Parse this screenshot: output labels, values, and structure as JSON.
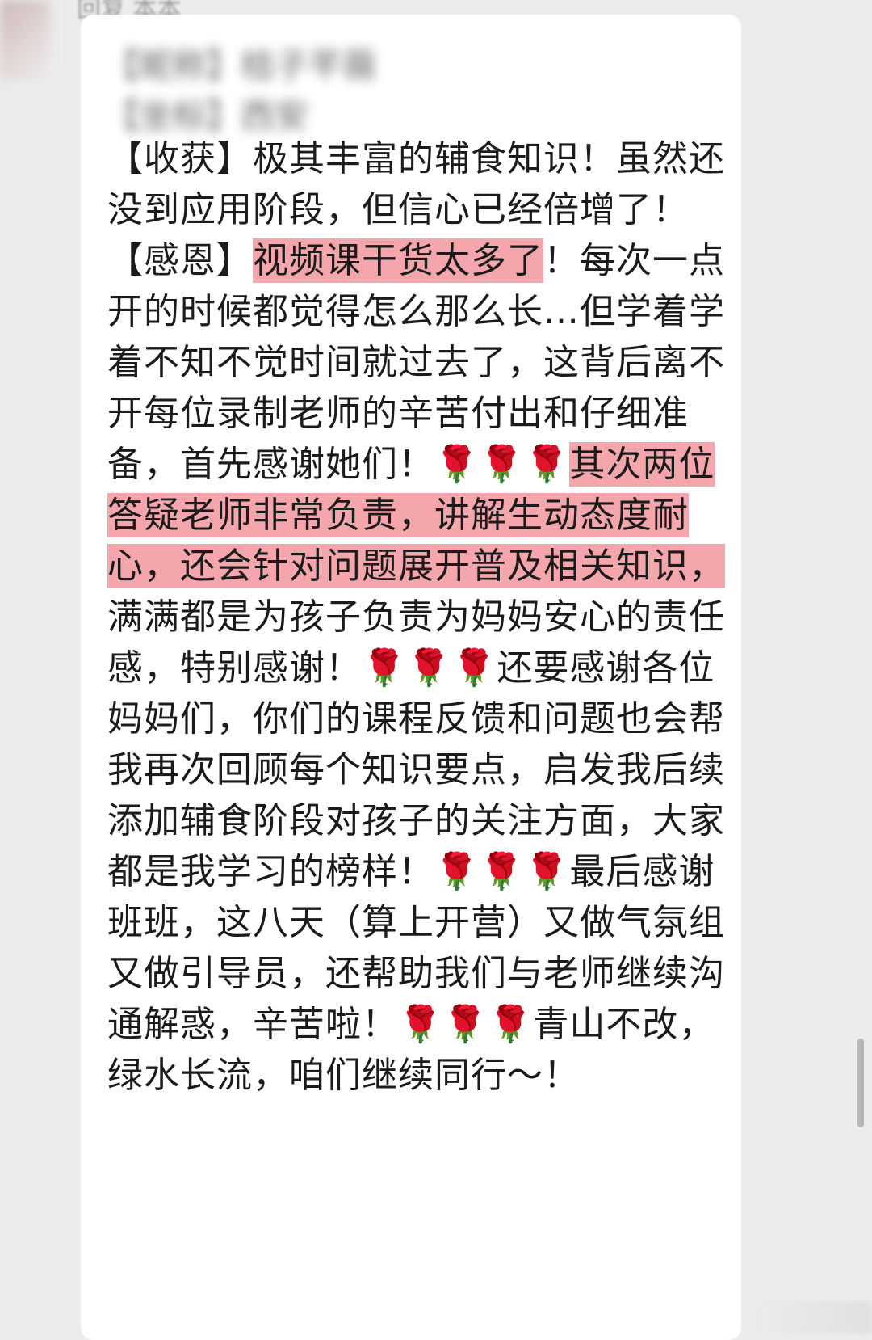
{
  "top_fragment": "回复 本本",
  "header_blurred": {
    "line1": "【昵称】桔子芊薇",
    "line2": "【坐标】西安"
  },
  "message": {
    "harvest_tag": "【收获】",
    "harvest_text": "极其丰富的辅食知识！虽然还没到应用阶段，但信心已经倍增了！",
    "thanks_tag": "【感恩】",
    "thanks_highlight_1": "视频课干货太多了",
    "thanks_part_1": "！每次一点开的时候都觉得怎么那么长…但学着学着不知不觉时间就过去了，这背后离不开每位录制老师的辛苦付出和仔细准备，首先感谢她们！🌹🌹🌹",
    "thanks_highlight_2": "其次两位答疑老师非常负责，讲解生动态度耐心，还会针对问题展开普及相关知识，",
    "thanks_part_2": "满满都是为孩子负责为妈妈安心的责任感，特别感谢！🌹🌹🌹还要感谢各位妈妈们，你们的课程反馈和问题也会帮我再次回顾每个知识要点，启发我后续添加辅食阶段对孩子的关注方面，大家都是我学习的榜样！🌹🌹🌹最后感谢班班，这八天（算上开营）又做气氛组又做引导员，还帮助我们与老师继续沟通解惑，辛苦啦！🌹🌹🌹青山不改，绿水长流，咱们继续同行～！"
  },
  "colors": {
    "highlight": "#f5a6ac",
    "bubble_bg": "#ffffff",
    "page_bg": "#ececec"
  }
}
